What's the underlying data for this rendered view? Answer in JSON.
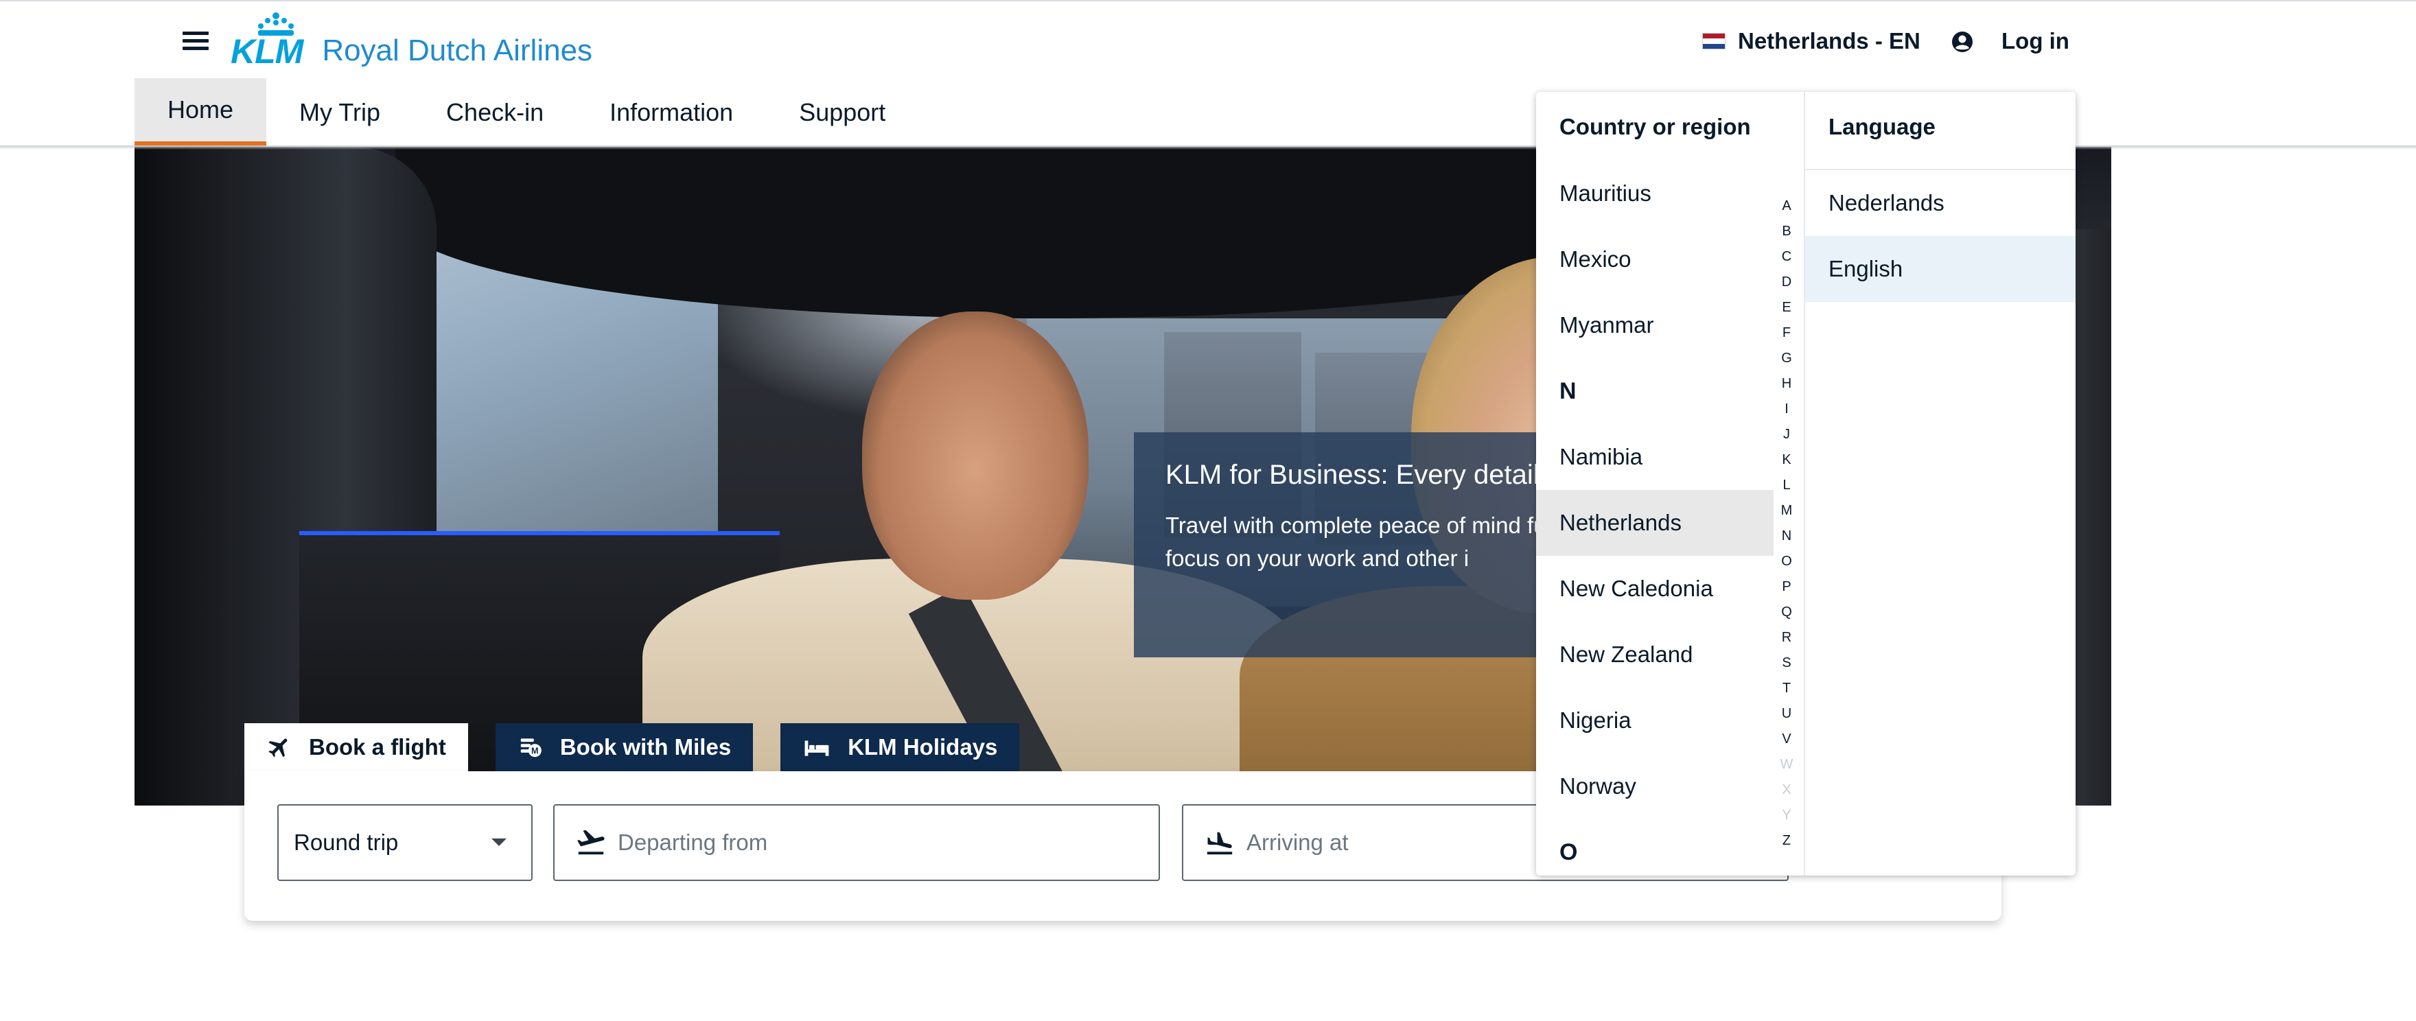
{
  "header": {
    "logo_text": "KLM",
    "brand": "Royal Dutch Airlines",
    "region_label": "Netherlands - EN",
    "login_label": "Log in"
  },
  "nav": {
    "items": [
      {
        "label": "Home",
        "active": true
      },
      {
        "label": "My Trip",
        "active": false
      },
      {
        "label": "Check-in",
        "active": false
      },
      {
        "label": "Information",
        "active": false
      },
      {
        "label": "Support",
        "active": false
      }
    ]
  },
  "hero": {
    "promo_title": "KLM for Business: Every detail",
    "promo_text": "Travel with complete peace of mind fully focus on your work and other i"
  },
  "booking": {
    "tabs": [
      {
        "label": "Book a flight",
        "icon": "plane-icon",
        "active": true
      },
      {
        "label": "Book with Miles",
        "icon": "miles-icon",
        "active": false
      },
      {
        "label": "KLM Holidays",
        "icon": "bed-icon",
        "active": false
      }
    ],
    "trip_type": "Round trip",
    "departing_placeholder": "Departing from",
    "arriving_placeholder": "Arriving at"
  },
  "dropdown": {
    "country_header": "Country or region",
    "language_header": "Language",
    "countries": [
      {
        "label": "Mauritius",
        "type": "country",
        "selected": false
      },
      {
        "label": "Mexico",
        "type": "country",
        "selected": false
      },
      {
        "label": "Myanmar",
        "type": "country",
        "selected": false
      },
      {
        "label": "N",
        "type": "letter",
        "selected": false
      },
      {
        "label": "Namibia",
        "type": "country",
        "selected": false
      },
      {
        "label": "Netherlands",
        "type": "country",
        "selected": true
      },
      {
        "label": "New Caledonia",
        "type": "country",
        "selected": false
      },
      {
        "label": "New Zealand",
        "type": "country",
        "selected": false
      },
      {
        "label": "Nigeria",
        "type": "country",
        "selected": false
      },
      {
        "label": "Norway",
        "type": "country",
        "selected": false
      },
      {
        "label": "O",
        "type": "letter",
        "selected": false
      }
    ],
    "alphabet": [
      "A",
      "B",
      "C",
      "D",
      "E",
      "F",
      "G",
      "H",
      "I",
      "J",
      "K",
      "L",
      "M",
      "N",
      "O",
      "P",
      "Q",
      "R",
      "S",
      "T",
      "U",
      "V",
      "W",
      "X",
      "Y",
      "Z"
    ],
    "alphabet_disabled": [
      "W",
      "X",
      "Y"
    ],
    "languages": [
      {
        "label": "Nederlands",
        "selected": false
      },
      {
        "label": "English",
        "selected": true
      }
    ]
  },
  "colors": {
    "brand_blue": "#00a1de",
    "nav_active_underline": "#e37222",
    "tab_dark": "#0e2a4c",
    "selected_country_bg": "#e8e8e8",
    "selected_language_bg": "#e9f1f9"
  }
}
